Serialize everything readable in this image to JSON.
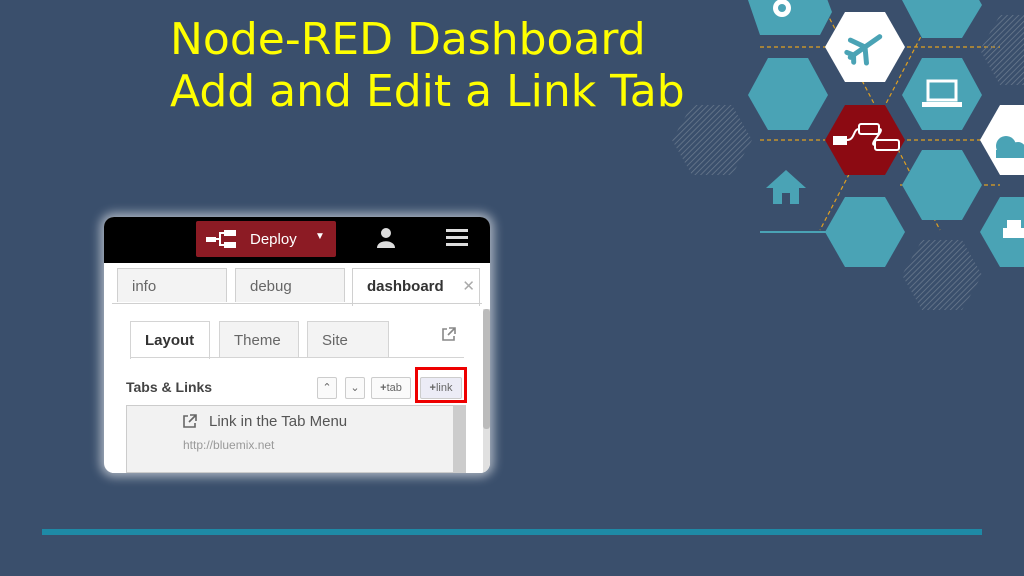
{
  "slide": {
    "title_line1": "Node-RED Dashboard",
    "title_line2": "Add and Edit a Link Tab"
  },
  "colors": {
    "background": "#3a4f6c",
    "title": "#ffff00",
    "deploy": "#8c1b24",
    "hex_teal": "#4aa3b5",
    "hex_red": "#8c0a12",
    "rule": "#1e8aa6",
    "highlight": "#e00000"
  },
  "decoration_icons": [
    "gear-icon",
    "airplane-icon",
    "laptop-icon",
    "node-flow-icon",
    "cloud-icon",
    "home-icon",
    "car-icon"
  ],
  "toolbar": {
    "deploy_label": "Deploy",
    "user_icon": "user-icon",
    "menu_icon": "hamburger-menu-icon"
  },
  "sidebar": {
    "tabs": [
      {
        "label": "info"
      },
      {
        "label": "debug"
      },
      {
        "label": "dashboard"
      }
    ],
    "subtabs": [
      {
        "label": "Layout"
      },
      {
        "label": "Theme"
      },
      {
        "label": "Site"
      }
    ],
    "section_title": "Tabs & Links",
    "buttons": {
      "tab": "tab",
      "link": "link"
    },
    "items": [
      {
        "name": "Link in the Tab Menu",
        "url": "http://bluemix.net"
      }
    ]
  }
}
